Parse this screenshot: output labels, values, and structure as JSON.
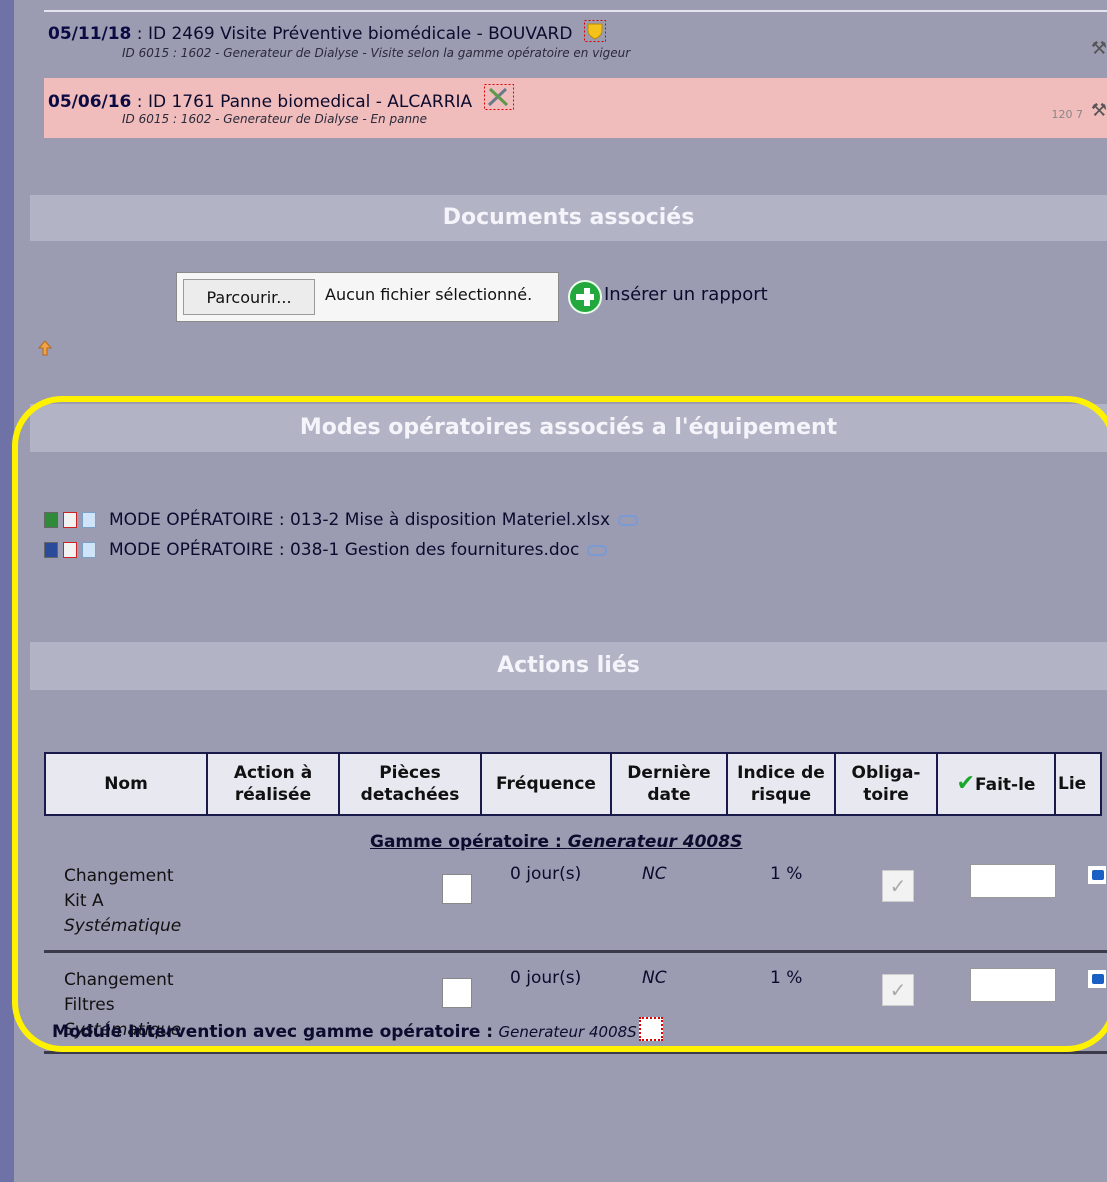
{
  "interventions": [
    {
      "date": "05/11/18",
      "title": "ID 2469 Visite Préventive biomédicale - BOUVARD",
      "detail": "ID 6015 : 1602 - Generateur de Dialyse - Visite selon la gamme opératoire en vigeur",
      "icon": "shield-icon"
    },
    {
      "date": "05/06/16",
      "title": "ID 1761 Panne biomedical - ALCARRIA",
      "detail": "ID 6015 : 1602 - Generateur de Dialyse - En panne",
      "icon": "tools-icon",
      "extra": "120 7"
    }
  ],
  "sections": {
    "documents": "Documents associés",
    "modes": "Modes opératoires associés a l'équipement",
    "actions": "Actions liés"
  },
  "upload": {
    "browse_label": "Parcourir...",
    "file_status": "Aucun fichier sélectionné.",
    "insert_label": "Insérer un rapport"
  },
  "modes_operatoires": [
    {
      "label": "MODE OPÉRATOIRE : 013-2 Mise à disposition Materiel.xlsx",
      "type": "excel-icon"
    },
    {
      "label": "MODE OPÉRATOIRE : 038-1 Gestion des fournitures.doc",
      "type": "word-icon"
    }
  ],
  "table": {
    "headers": [
      "Nom",
      "Action à réalisée",
      "Pièces detachées",
      "Fréquence",
      "Dernière date",
      "Indice de risque",
      "Obliga-toire",
      "Fait-le",
      "Lie"
    ],
    "gamme_prefix": "Gamme opératoire : ",
    "gamme_name": "Generateur 4008S",
    "rows": [
      {
        "name1": "Changement",
        "name2": "Kit A",
        "type": "Systématique",
        "freq": "0 jour(s)",
        "last": "NC",
        "risk": "1 %"
      },
      {
        "name1": "Changement",
        "name2": "Filtres",
        "type": "Systématique",
        "freq": "0 jour(s)",
        "last": "NC",
        "risk": "1 %"
      }
    ]
  },
  "module": {
    "label": "Module Intervention avec gamme opératoire :",
    "name": "Generateur 4008S"
  },
  "colors": {
    "background": "#9b9bb2",
    "section_bar": "#b3b3c6",
    "panne_row": "#f0bcbc",
    "highlight": "#fff200"
  }
}
